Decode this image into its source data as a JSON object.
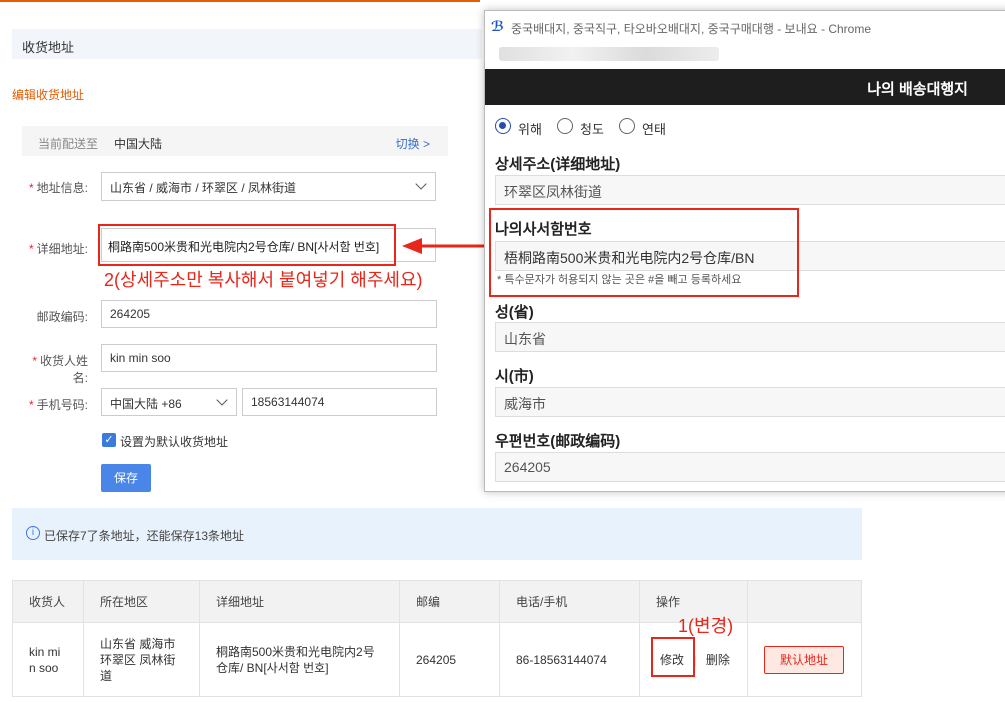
{
  "header": {
    "section_title": "收货地址",
    "edit_title": "编辑收货地址"
  },
  "shipping": {
    "label": "当前配送至",
    "value": "中国大陆",
    "switch": "切换 >"
  },
  "form": {
    "region_label": "地址信息:",
    "region_value": "山东省 / 威海市 / 环翠区 / 凤林街道",
    "detail_label": "详细地址:",
    "detail_value": "桐路南500米贵和光电院内2号仓库/ BN[사서함 번호]",
    "postal_label": "邮政编码:",
    "postal_value": "264205",
    "name_label": "收货人姓名:",
    "name_value": "kin min soo",
    "phone_label": "手机号码:",
    "phone_country": "中国大陆 +86",
    "phone_value": "18563144074",
    "default_checkbox": "设置为默认收货地址",
    "save_button": "保存"
  },
  "annotation": {
    "step2": "2(상세주소만 복사해서 붙여넣기 해주세요)",
    "step1": "1(변경)"
  },
  "info": {
    "icon": "info-icon",
    "text": "已保存7了条地址，还能保存13条地址"
  },
  "table": {
    "headers": [
      "收货人",
      "所在地区",
      "详细地址",
      "邮编",
      "电话/手机",
      "操作",
      ""
    ],
    "row": {
      "name": "kin mi n soo",
      "region": "山东省 威海市 环翠区 凤林街道",
      "detail": "桐路南500米贵和光电院内2号仓库/ BN[사서함 번호]",
      "postal": "264205",
      "phone": "86-18563144074",
      "edit": "修改",
      "delete": "删除",
      "default_btn": "默认地址"
    }
  },
  "popup": {
    "window_title": "중국배대지, 중국직구, 타오바오배대지, 중국구매대행 - 보내요 - Chrome",
    "header": "나의 배송대행지",
    "radios": [
      "위해",
      "청도",
      "연태"
    ],
    "selected_radio": "위해",
    "detail_label": "상세주소(详细地址)",
    "detail_value": "环翠区凤林街道",
    "pobox_label": "나의사서함번호",
    "pobox_value": "梧桐路南500米贵和光电院内2号仓库/BN",
    "pobox_note": "* 특수문자가 허용되지 않는 곳은 #을 빼고 등록하세요",
    "province_label": "성(省)",
    "province_value": "山东省",
    "city_label": "시(市)",
    "city_value": "威海市",
    "zip_label": "우편번호(邮政编码)",
    "zip_value": "264205"
  },
  "colors": {
    "accent": "#e65c00",
    "primary": "#4a86e8",
    "annotation": "#e8261a"
  }
}
